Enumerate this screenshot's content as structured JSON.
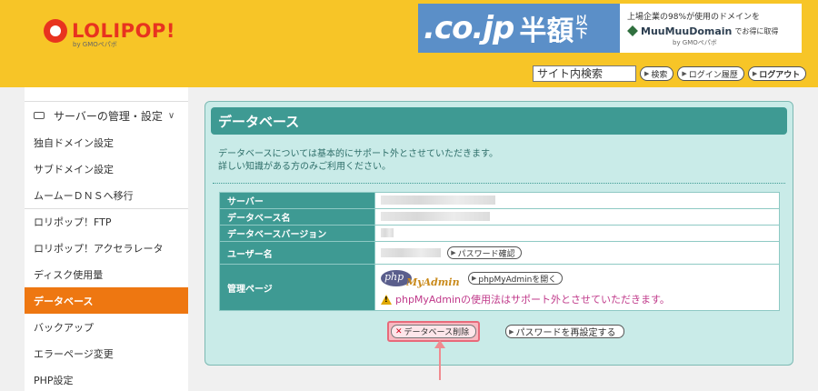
{
  "header": {
    "logo_text": "LOLIPOP!",
    "logo_sub": "by GMOペパボ",
    "banner": {
      "domain": ".co.jp",
      "half": "半額",
      "ika_top": "以",
      "ika_bottom": "下",
      "line1": "上場企業の98%が使用のドメインを",
      "brand": "MuuMuuDomain",
      "tag": "でお得に取得",
      "sub": "by GMOペパボ"
    },
    "search_placeholder": "サイト内検索",
    "buttons": {
      "search": "検索",
      "login_history": "ログイン履歴",
      "logout": "ログアウト"
    }
  },
  "sidebar": {
    "section": "サーバーの管理・設定",
    "items": [
      "独自ドメイン設定",
      "サブドメイン設定",
      "ムームーＤＮＳへ移行",
      "ロリポップ！FTP",
      "ロリポップ！アクセラレータ",
      "ディスク使用量",
      "データベース",
      "バックアップ",
      "エラーページ変更",
      "PHP設定"
    ],
    "active_index": 6
  },
  "main": {
    "title": "データベース",
    "desc_line1": "データベースについては基本的にサポート外とさせていただきます。",
    "desc_line2": "詳しい知識がある方のみご利用ください。",
    "table": {
      "server_label": "サーバー",
      "dbname_label": "データベース名",
      "dbversion_label": "データベースバージョン",
      "username_label": "ユーザー名",
      "password_btn": "パスワード確認",
      "admin_label": "管理ページ",
      "pma_php": "php",
      "pma_my": "MyAdmin",
      "pma_btn": "phpMyAdminを開く",
      "warning": "phpMyAdminの使用法はサポート外とさせていただきます。"
    },
    "delete_btn": "データベース削除",
    "reset_btn": "パスワードを再設定する"
  },
  "colors": {
    "header_bg": "#f7c527",
    "panel_bg": "#c9ebe8",
    "panel_title": "#3e9a93",
    "active_item": "#ee7711",
    "warning_text": "#c0398a",
    "highlight": "#e86a7a"
  }
}
